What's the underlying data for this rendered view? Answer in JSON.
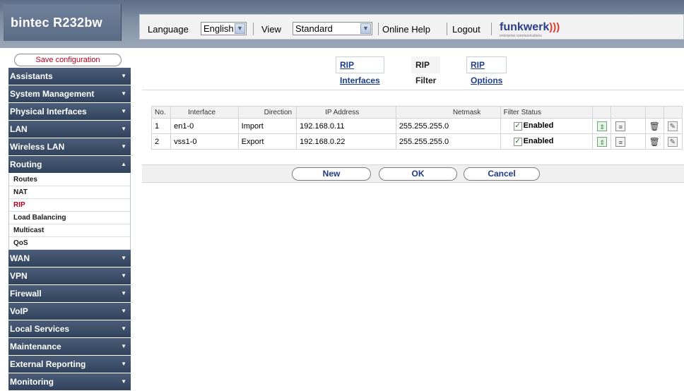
{
  "header": {
    "brand": "bintec R232bw",
    "language_label": "Language",
    "language_value": "English",
    "view_label": "View",
    "view_value": "Standard",
    "online_help": "Online Help",
    "logout": "Logout",
    "logo_text": "funkwerk",
    "logo_waves": ")))",
    "logo_sub": "enterprise communications"
  },
  "sidebar": {
    "save_label": "Save configuration",
    "items": [
      {
        "label": "Assistants",
        "caret": "▼"
      },
      {
        "label": "System Management",
        "caret": "▼"
      },
      {
        "label": "Physical Interfaces",
        "caret": "▼"
      },
      {
        "label": "LAN",
        "caret": "▼"
      },
      {
        "label": "Wireless LAN",
        "caret": "▼"
      },
      {
        "label": "Routing",
        "caret": "▲"
      },
      {
        "label": "WAN",
        "caret": "▼"
      },
      {
        "label": "VPN",
        "caret": "▼"
      },
      {
        "label": "Firewall",
        "caret": "▼"
      },
      {
        "label": "VoIP",
        "caret": "▼"
      },
      {
        "label": "Local Services",
        "caret": "▼"
      },
      {
        "label": "Maintenance",
        "caret": "▼"
      },
      {
        "label": "External Reporting",
        "caret": "▼"
      },
      {
        "label": "Monitoring",
        "caret": "▼"
      }
    ],
    "routing_sub": [
      "Routes",
      "NAT",
      "RIP",
      "Load Balancing",
      "Multicast",
      "QoS"
    ]
  },
  "tabs": {
    "rip_interfaces": "RIP Interfaces",
    "rip_filter": "RIP Filter",
    "rip_options": "RIP Options"
  },
  "table": {
    "headers": [
      "No.",
      "Interface",
      "Direction",
      "IP Address",
      "Netmask",
      "Filter Status"
    ],
    "rows": [
      {
        "no": "1",
        "interface": "en1-0",
        "direction": "Import",
        "ip": "192.168.0.11",
        "netmask": "255.255.255.0",
        "status": "Enabled",
        "check": "✓"
      },
      {
        "no": "2",
        "interface": "vss1-0",
        "direction": "Export",
        "ip": "192.168.0.22",
        "netmask": "255.255.255.0",
        "status": "Enabled",
        "check": "✓"
      }
    ]
  },
  "buttons": {
    "new": "New",
    "ok": "OK",
    "cancel": "Cancel"
  },
  "icons": {
    "move": "⇕",
    "edit": "≡",
    "delete": "🗑",
    "pencil": "✎",
    "select_arrow": "▼"
  },
  "colors": {
    "sidebar_bg": "#31425c",
    "header_bg": "#7d8da2",
    "active_link": "#b5001f",
    "tab_link": "#1e3c8a"
  }
}
